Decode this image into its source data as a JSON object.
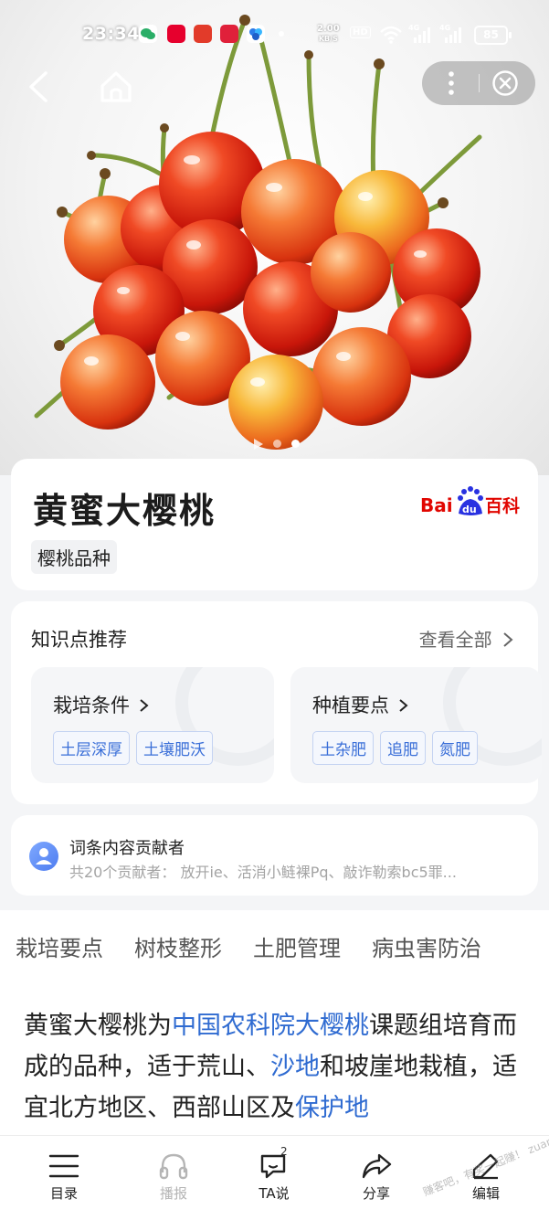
{
  "status_bar": {
    "time": "23:34",
    "net_speed_value": "2.00",
    "net_speed_unit": "KB/S",
    "hd_label": "HD",
    "signal_label": "4G",
    "battery": "85"
  },
  "hero": {
    "image_desc": "cherries",
    "carousel_count": 3,
    "active_index": 2
  },
  "title_card": {
    "title": "黄蜜大樱桃",
    "tag": "樱桃品种",
    "logo_text_bai": "Bai",
    "logo_text_du": "du",
    "logo_text_baike": "百科"
  },
  "knowledge": {
    "title": "知识点推荐",
    "view_all": "查看全部",
    "boxes": [
      {
        "title": "栽培条件",
        "tags": [
          "土层深厚",
          "土壤肥沃"
        ]
      },
      {
        "title": "种植要点",
        "tags": [
          "土杂肥",
          "追肥",
          "氮肥"
        ]
      }
    ]
  },
  "contributors": {
    "title": "词条内容贡献者",
    "subtitle": "共20个贡献者：  放开ie、活消小鲢裸Pq、敲诈勒索bc5罪..."
  },
  "tabs": [
    "栽培要点",
    "树枝整形",
    "土肥管理",
    "病虫害防治"
  ],
  "paragraph": {
    "t1": "黄蜜大樱桃为",
    "l1": "中国农科院大樱桃",
    "t2": "课题组培育而成的品种，适于荒山、",
    "l2": "沙地",
    "t3": "和坡崖地栽植，适宜北方地区、西部山区及",
    "l3": "保护地"
  },
  "bottom_bar": {
    "items": [
      {
        "label": "目录"
      },
      {
        "label": "播报"
      },
      {
        "label": "TA说",
        "badge": "2"
      },
      {
        "label": "分享"
      },
      {
        "label": "编辑"
      }
    ],
    "watermark": "赚客吧，有奖一起赚！ zuanke8.com"
  },
  "colors": {
    "link": "#2f6bd1",
    "baidu_red": "#e10601",
    "baidu_blue": "#2932e1"
  }
}
